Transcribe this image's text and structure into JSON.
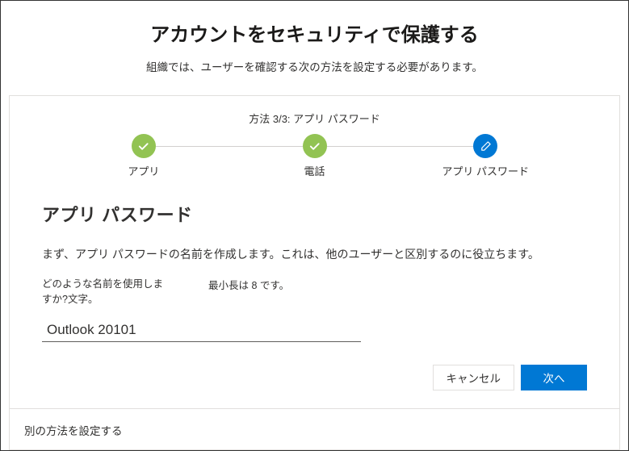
{
  "header": {
    "title": "アカウントをセキュリティで保護する",
    "subtitle": "組織では、ユーザーを確認する次の方法を設定する必要があります。"
  },
  "stepper": {
    "counter": "方法 3/3: アプリ パスワード",
    "steps": [
      {
        "label": "アプリ",
        "status": "done"
      },
      {
        "label": "電話",
        "status": "done"
      },
      {
        "label": "アプリ パスワード",
        "status": "current"
      }
    ]
  },
  "form": {
    "section_title": "アプリ パスワード",
    "description": "まず、アプリ パスワードの名前を作成します。これは、他のユーザーと区別するのに役立ちます。",
    "name_label": "どのような名前を使用しますか?文字。",
    "min_length_text": "最小長は 8 です。",
    "input_value": "Outlook 20101"
  },
  "buttons": {
    "cancel": "キャンセル",
    "next": "次へ"
  },
  "footer": {
    "alt_method": "別の方法を設定する"
  },
  "colors": {
    "done": "#92c353",
    "current": "#0078d4"
  }
}
